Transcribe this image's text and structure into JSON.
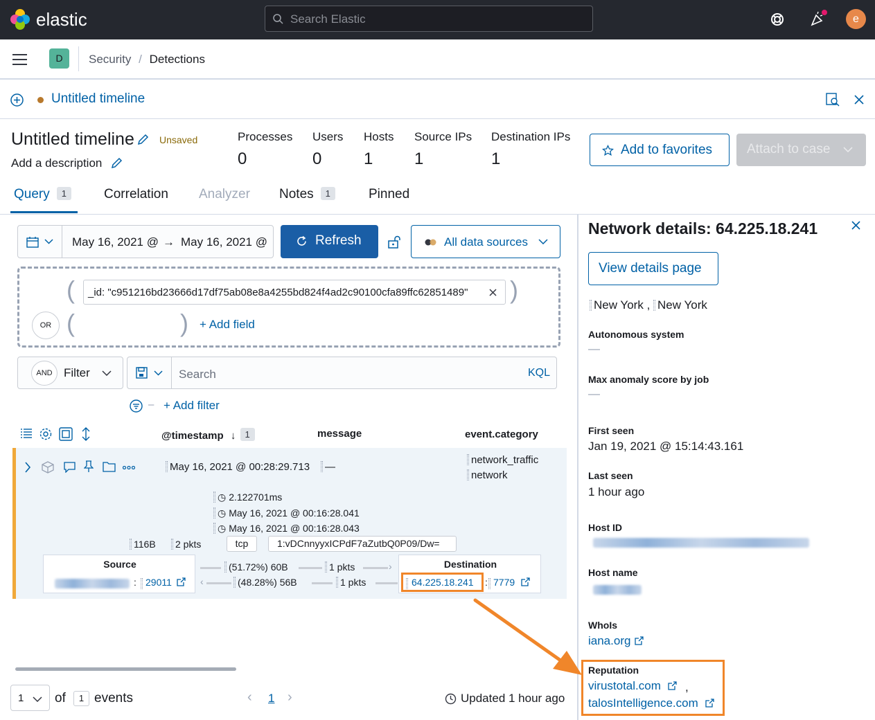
{
  "app": {
    "brand": "elastic",
    "search_placeholder": "Search Elastic",
    "user_initial": "e"
  },
  "breadcrumbs": {
    "space_initial": "D",
    "items": [
      "Security",
      "Detections"
    ],
    "separator": "/"
  },
  "timeline_bar": {
    "title": "Untitled timeline"
  },
  "timeline_header": {
    "title": "Untitled timeline",
    "status": "Unsaved",
    "description_placeholder": "Add a description",
    "stats": [
      {
        "label": "Processes",
        "value": "0"
      },
      {
        "label": "Users",
        "value": "0"
      },
      {
        "label": "Hosts",
        "value": "1"
      },
      {
        "label": "Source IPs",
        "value": "1"
      },
      {
        "label": "Destination IPs",
        "value": "1"
      }
    ],
    "add_favorites_label": "Add to favorites",
    "attach_case_label": "Attach to case"
  },
  "tabs": [
    {
      "label": "Query",
      "badge": "1",
      "active": true
    },
    {
      "label": "Correlation"
    },
    {
      "label": "Analyzer",
      "disabled": true
    },
    {
      "label": "Notes",
      "badge": "1"
    },
    {
      "label": "Pinned"
    }
  ],
  "query": {
    "date_start": "May 16, 2021 @",
    "date_arrow": "→",
    "date_end": "May 16, 2021 @",
    "refresh_label": "Refresh",
    "data_sources_label": "All data sources",
    "provider_id": "_id: \"c951216bd23666d17df75ab08e8a4255bd824f4ad2c90100cfa89ffc62851489\"",
    "or_label": "OR",
    "add_field_label": "+ Add field",
    "and_label": "AND",
    "filter_label": "Filter",
    "search_placeholder": "Search",
    "kql_label": "KQL",
    "add_filter_label": "+ Add filter"
  },
  "table": {
    "columns": [
      "@timestamp",
      "message",
      "event.category"
    ],
    "sort_badge": "1",
    "row": {
      "timestamp": "May 16, 2021 @ 00:28:29.713",
      "message": "—",
      "category_1": "network_traffic",
      "category_2": "network",
      "duration": "2.122701ms",
      "start": "May 16, 2021 @ 00:16:28.041",
      "end": "May 16, 2021 @ 00:16:28.043",
      "bytes": "116B",
      "packets": "2 pkts",
      "protocol": "tcp",
      "community_id": "1:vDCnnyyxICPdF7aZutbQ0P09/Dw=",
      "source_title": "Source",
      "source_port": "29011",
      "src_out_pct": "(51.72%) 60B",
      "src_out_pkts": "1 pkts",
      "src_in_pct": "(48.28%) 56B",
      "src_in_pkts": "1 pkts",
      "destination_title": "Destination",
      "destination_ip": "64.225.18.241",
      "destination_port": "7779",
      "colon": ":"
    }
  },
  "footer": {
    "rows_per_page": "1",
    "of_label": "of",
    "total": "1",
    "events_label": "events",
    "page": "1",
    "updated": "Updated 1 hour ago"
  },
  "side_panel": {
    "title": "Network details: 64.225.18.241",
    "view_details_label": "View details page",
    "location_city": "New York",
    "location_sep": ",",
    "location_region": "New York",
    "autonomous_system_label": "Autonomous system",
    "autonomous_system_value": "—",
    "max_anomaly_label": "Max anomaly score by job",
    "max_anomaly_value": "—",
    "first_seen_label": "First seen",
    "first_seen_value": "Jan 19, 2021 @ 15:14:43.161",
    "last_seen_label": "Last seen",
    "last_seen_value": "1 hour ago",
    "host_id_label": "Host ID",
    "host_name_label": "Host name",
    "whois_label": "WhoIs",
    "whois_link": "iana.org",
    "reputation_label": "Reputation",
    "reputation_link_1": "virustotal.com",
    "reputation_sep": ",",
    "reputation_link_2": "talosIntelligence.com"
  },
  "colors": {
    "accent": "#0061a6",
    "highlight": "#f0862a",
    "row_stripe": "#f0a83a",
    "topbar": "#25282f",
    "refresh": "#1a5ea6"
  }
}
